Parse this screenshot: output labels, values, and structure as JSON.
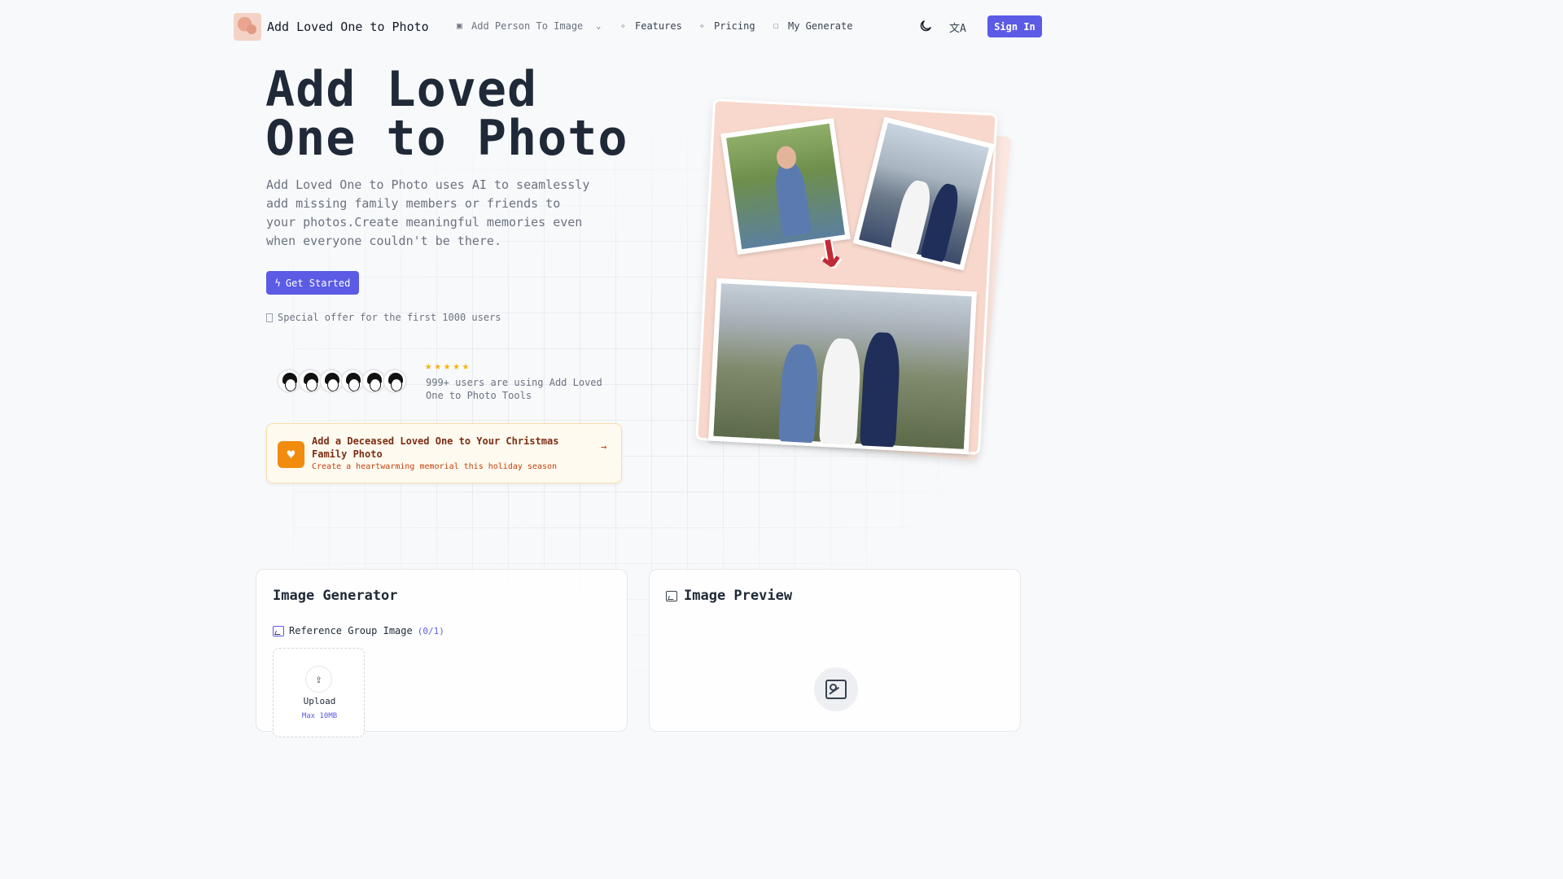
{
  "nav": {
    "brand": "Add Loved One to Photo",
    "items": [
      {
        "label": "Add Person To Image",
        "icon": "robot-icon",
        "has_dropdown": true
      },
      {
        "label": "Features",
        "icon": "sparkles-icon"
      },
      {
        "label": "Pricing",
        "icon": "sparkles-icon"
      },
      {
        "label": "My Generate",
        "icon": "external-box-icon"
      }
    ],
    "sign_in": "Sign In"
  },
  "hero": {
    "title_line1": "Add Loved",
    "title_line2": "One to Photo",
    "description": "Add Loved One to Photo uses AI to seamlessly add missing family members or friends to your photos.Create meaningful memories even when everyone couldn't be there.",
    "cta": "Get Started",
    "offer": "Special offer for the first 1000 users",
    "rating_stars": 5,
    "users_text": "999+ users are using Add Loved One to Photo Tools"
  },
  "promo": {
    "title": "Add a Deceased Loved One to Your Christmas Family Photo",
    "subtitle": "Create a heartwarming memorial this holiday season"
  },
  "generator": {
    "title": "Image Generator",
    "reference_label": "Reference Group Image",
    "reference_count": "(0/1)",
    "upload_label": "Upload",
    "upload_max": "Max 10MB"
  },
  "preview": {
    "title": "Image Preview"
  },
  "colors": {
    "accent": "#5b5be6",
    "promo_orange": "#f28c0f",
    "star": "#f5b50a",
    "arrow_red": "#c02a37"
  }
}
